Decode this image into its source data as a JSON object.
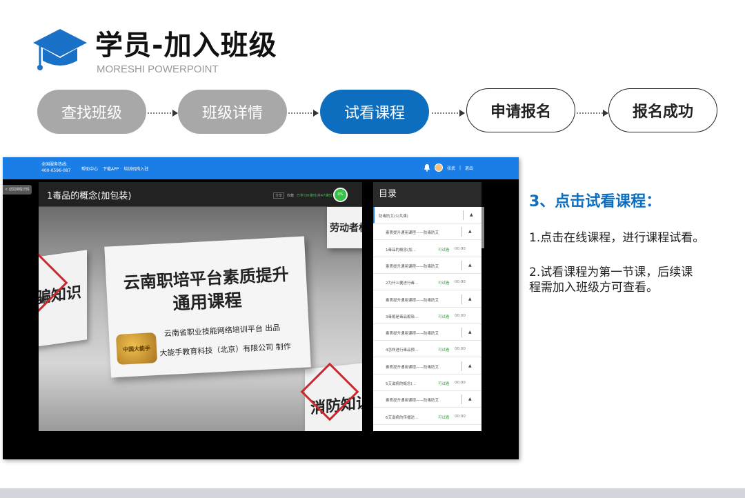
{
  "header": {
    "title": "学员-加入班级",
    "subtitle": "MORESHI POWERPOINT"
  },
  "steps": [
    {
      "label": "查找班级",
      "state": "done"
    },
    {
      "label": "班级详情",
      "state": "done"
    },
    {
      "label": "试看课程",
      "state": "active"
    },
    {
      "label": "申请报名",
      "state": "todo"
    },
    {
      "label": "报名成功",
      "state": "todo"
    }
  ],
  "colors": {
    "active": "#0d6ec0",
    "done": "#a8a8a8",
    "nav": "#1a7ee6",
    "trial": "#39a84a"
  },
  "app": {
    "hotline_label": "全国服务热线:",
    "hotline_number": "400-0596-087",
    "nav_links": [
      "帮助中心",
      "下载APP",
      "培训机构入驻"
    ],
    "user_name": "张武",
    "logout": "退出",
    "back_label": "< 返回课程详情",
    "video_title": "1毒品的概念(加包装)",
    "video_meta_btn": "分享",
    "video_meta_btn2": "收藏",
    "video_meta_progress": "已学习0课时/共47课时",
    "progress_percent": "0%",
    "catalog_title": "目录",
    "catalog_rows": [
      {
        "label": "防毒防艾(公共课)",
        "type": "section"
      },
      {
        "label": "素质提升通用课程——防毒防艾",
        "type": "chapter"
      },
      {
        "label": "1毒品的概念(加...",
        "type": "lesson",
        "trial": "可试看",
        "duration": "00:00"
      },
      {
        "label": "素质提升通用课程——防毒防艾",
        "type": "chapter"
      },
      {
        "label": "2为什么要进行毒...",
        "type": "lesson",
        "trial": "可试看",
        "duration": "00:00"
      },
      {
        "label": "素质提升通用课程——防毒防艾",
        "type": "chapter"
      },
      {
        "label": "3毒贩是毒品贩染...",
        "type": "lesson",
        "trial": "可试看",
        "duration": "00:00"
      },
      {
        "label": "素质提升通用课程——防毒防艾",
        "type": "chapter"
      },
      {
        "label": "4怎样进行毒品预...",
        "type": "lesson",
        "trial": "可试看",
        "duration": "00:00"
      },
      {
        "label": "素质提升通用课程——防毒防艾",
        "type": "chapter"
      },
      {
        "label": "5艾滋病的概念(...",
        "type": "lesson",
        "trial": "可试看",
        "duration": "00:00"
      },
      {
        "label": "素质提升通用课程——防毒防艾",
        "type": "chapter"
      },
      {
        "label": "6艾滋病的传播途...",
        "type": "lesson",
        "trial": "可试看",
        "duration": "00:00"
      }
    ],
    "video_board": {
      "line1": "云南职培平台素质提升",
      "line2": "通用课程",
      "line3": "云南省职业技能网络培训平台 出品",
      "line4": "大能手教育科技（北京）有限公司 制作",
      "seal": "中国大能手",
      "left_board": "骗知识",
      "top_right_board": "劳动者权",
      "bottom_right_board": "消防知识"
    }
  },
  "side": {
    "heading": "3、点击试看课程：",
    "p1": "1.点击在线课程，进行课程试看。",
    "p2_line1": "2.试看课程为第一节课，后续课",
    "p2_line2": "程需加入班级方可查看。"
  }
}
